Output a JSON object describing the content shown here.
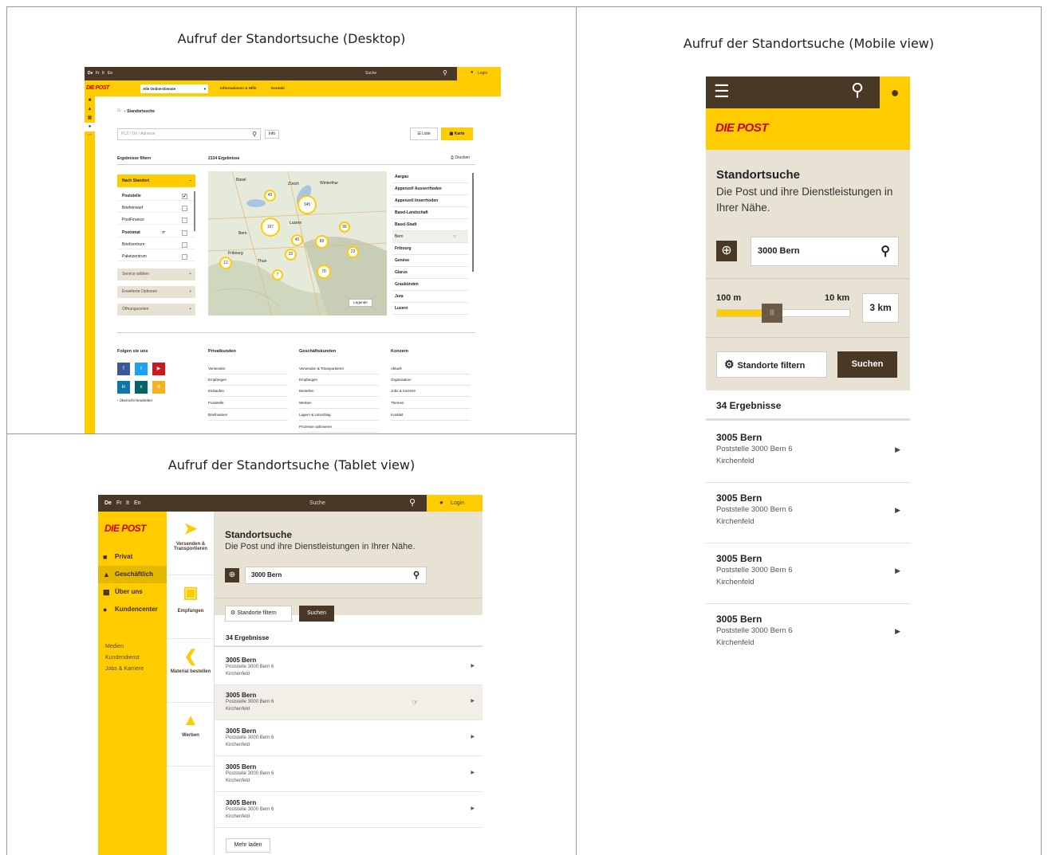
{
  "captions": {
    "desktop": "Aufruf der Standortsuche (Desktop)",
    "mobile": "Aufruf der Standortsuche (Mobile view)",
    "tablet": "Aufruf der Standortsuche (Tablet view)"
  },
  "colors": {
    "brand_yellow": "#ffcc00",
    "brand_brown": "#4a3826",
    "beige": "#e8e2d4",
    "logo_red": "#cc0000"
  },
  "brand": {
    "logo": "DIE POST"
  },
  "desktop": {
    "langs": [
      "De",
      "Fr",
      "It",
      "En"
    ],
    "search_label": "Suche",
    "login": "Login",
    "dropdown": "Alle Online-Dienste",
    "menu1": "Informationen & Hilfe",
    "menu2": "Kontakt",
    "breadcrumb": "Standortsuche",
    "search_placeholder": "PLZ / Ort / Adresse",
    "info_button": "Info",
    "view_list": "Liste",
    "view_map": "Karte",
    "filter_title": "Ergebnisse filtern",
    "results_count": "2134 Ergebnisse",
    "print": "Drucken",
    "filter_section": "Nach Standort",
    "filter_items": [
      "Poststelle",
      "Briefeinwurf",
      "PostFinance",
      "Postomat",
      "Briefzentrum",
      "Paketzentrum"
    ],
    "accordions": [
      "Service wählen",
      "Erweiterte Optionen",
      "Öffnungszeiten"
    ],
    "cantons": [
      "Aargau",
      "Appenzell Ausserrhoden",
      "Appenzell Innerrhoden",
      "Basel-Landschaft",
      "Basel-Stadt",
      "Bern",
      "Fribourg",
      "Genève",
      "Glarus",
      "Graubünden",
      "Jura",
      "Luzern"
    ],
    "map_clusters": [
      "45",
      "345",
      "167",
      "89",
      "33",
      "12",
      "7",
      "78",
      "23",
      "96",
      "45"
    ],
    "map_legend": "Legende",
    "map_labels": [
      "Zürich",
      "Bern",
      "Luzern",
      "Winterthur",
      "Basel",
      "Fribourg",
      "Thun"
    ],
    "footer": {
      "social_title": "Folgen sie uns",
      "newsletter": "Übersicht Newsletter",
      "col1_title": "Privatkunden",
      "col1": [
        "Versenden",
        "Empfangen",
        "Einkaufen",
        "Poststelle",
        "Briefmarken"
      ],
      "col2_title": "Geschäftskunden",
      "col2": [
        "Versenden & Transportieren",
        "Empfangen",
        "Bestellen",
        "Werben",
        "Lagern & Umschlag",
        "Prozesse optimieren"
      ],
      "col3_title": "Konzern",
      "col3": [
        "Aktuell",
        "Organisation",
        "Jobs & Karriere",
        "Themen",
        "Kontakt"
      ]
    }
  },
  "tablet": {
    "langs": [
      "De",
      "Fr",
      "It",
      "En"
    ],
    "search_label": "Suche",
    "login": "Login",
    "nav": [
      "Privat",
      "Geschäftlich",
      "Über uns",
      "Kundencenter"
    ],
    "subnav": [
      "Medien",
      "Kundendienst",
      "Jobs & Karriere"
    ],
    "sec_nav": [
      "Versenden & Transportieren",
      "Empfangen",
      "Material bestellen",
      "Werben"
    ],
    "title": "Standortsuche",
    "subtitle": "Die Post und ihre Dienstleistungen in Ihrer Nähe.",
    "search_value": "3000 Bern",
    "filter_button": "Standorte filtern",
    "search_button": "Suchen",
    "results_count": "34 Ergebnisse",
    "results": [
      {
        "city": "3005 Bern",
        "line1": "Poststelle 3000 Bern 6",
        "line2": "Kirchenfeld"
      },
      {
        "city": "3005 Bern",
        "line1": "Poststelle 3000 Bern 6",
        "line2": "Kirchenfeld"
      },
      {
        "city": "3005 Bern",
        "line1": "Poststelle 3000 Bern 6",
        "line2": "Kirchenfeld"
      },
      {
        "city": "3005 Bern",
        "line1": "Poststelle 3000 Bern 6",
        "line2": "Kirchenfeld"
      },
      {
        "city": "3005 Bern",
        "line1": "Poststelle 3000 Bern 6",
        "line2": "Kirchenfeld"
      }
    ],
    "load_more": "Mehr laden"
  },
  "mobile": {
    "title": "Standortsuche",
    "subtitle": "Die Post und ihre Dienstleistungen in Ihrer Nähe.",
    "search_value": "3000 Bern",
    "range_min": "100 m",
    "range_max": "10 km",
    "range_value": "3 km",
    "range_fraction": 0.4,
    "filter_button": "Standorte filtern",
    "search_button": "Suchen",
    "results_count": "34 Ergebnisse",
    "results": [
      {
        "city": "3005 Bern",
        "line1": "Poststelle 3000 Bern 6",
        "line2": "Kirchenfeld"
      },
      {
        "city": "3005 Bern",
        "line1": "Poststelle 3000 Bern 6",
        "line2": "Kirchenfeld"
      },
      {
        "city": "3005 Bern",
        "line1": "Poststelle 3000 Bern 6",
        "line2": "Kirchenfeld"
      },
      {
        "city": "3005 Bern",
        "line1": "Poststelle 3000 Bern 6",
        "line2": "Kirchenfeld"
      }
    ]
  }
}
